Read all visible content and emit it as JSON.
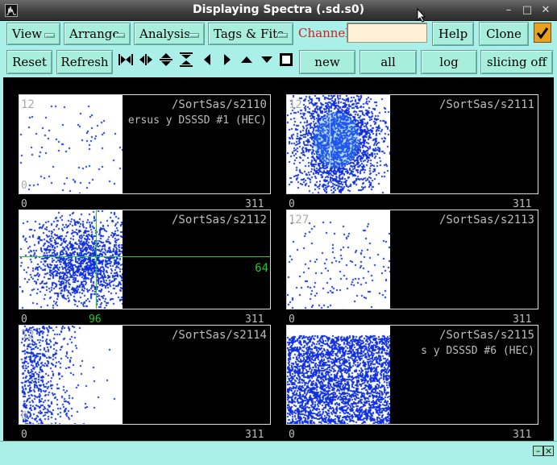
{
  "window": {
    "title": "Displaying Spectra (.sd.s0)"
  },
  "menus": [
    {
      "label": "View"
    },
    {
      "label": "Arrange"
    },
    {
      "label": "Analysis"
    },
    {
      "label": "Tags & Fits"
    }
  ],
  "channel": {
    "label": "Channel:",
    "value": ""
  },
  "buttons": {
    "help": "Help",
    "clone": "Clone",
    "reset": "Reset",
    "refresh": "Refresh",
    "new": "new",
    "all": "all",
    "log": "log",
    "slicing": "slicing off"
  },
  "icons": [
    "expand-horizontal-icon",
    "shrink-horizontal-icon",
    "expand-vertical-icon",
    "shrink-vertical-icon",
    "arrow-left-icon",
    "arrow-right-icon",
    "arrow-up-icon",
    "arrow-down-icon",
    "stop-square-icon"
  ],
  "colors": {
    "accent": "#aaf0e8",
    "plot_points": "#1030e0",
    "cursor_line": "#22cc22",
    "channel_label": "#d02020"
  },
  "spectra": [
    {
      "name": "/SortSas/s2110",
      "subtitle": "ersus y DSSSD #1 (HEC)",
      "ytop": "12",
      "yzero": "0",
      "xmin": "0",
      "xmax": "311"
    },
    {
      "name": "/SortSas/s2111",
      "subtitle": "",
      "ytop": "12",
      "yzero": "",
      "xmin": "0",
      "xmax": "311"
    },
    {
      "name": "/SortSas/s2112",
      "subtitle": "",
      "ytop": "",
      "yzero": "",
      "xmin": "0",
      "xmax": "311",
      "y_marker": "64",
      "x_marker": "96"
    },
    {
      "name": "/SortSas/s2113",
      "subtitle": "",
      "ytop": "127",
      "yzero": "",
      "xmin": "0",
      "xmax": "311"
    },
    {
      "name": "/SortSas/s2114",
      "subtitle": "",
      "ytop": "12",
      "yzero": "0",
      "xmin": "0",
      "xmax": "311"
    },
    {
      "name": "/SortSas/s2115",
      "subtitle": "s y DSSSD #6 (HEC)",
      "ytop": "",
      "yzero": "",
      "xmin": "0",
      "xmax": "311"
    }
  ]
}
